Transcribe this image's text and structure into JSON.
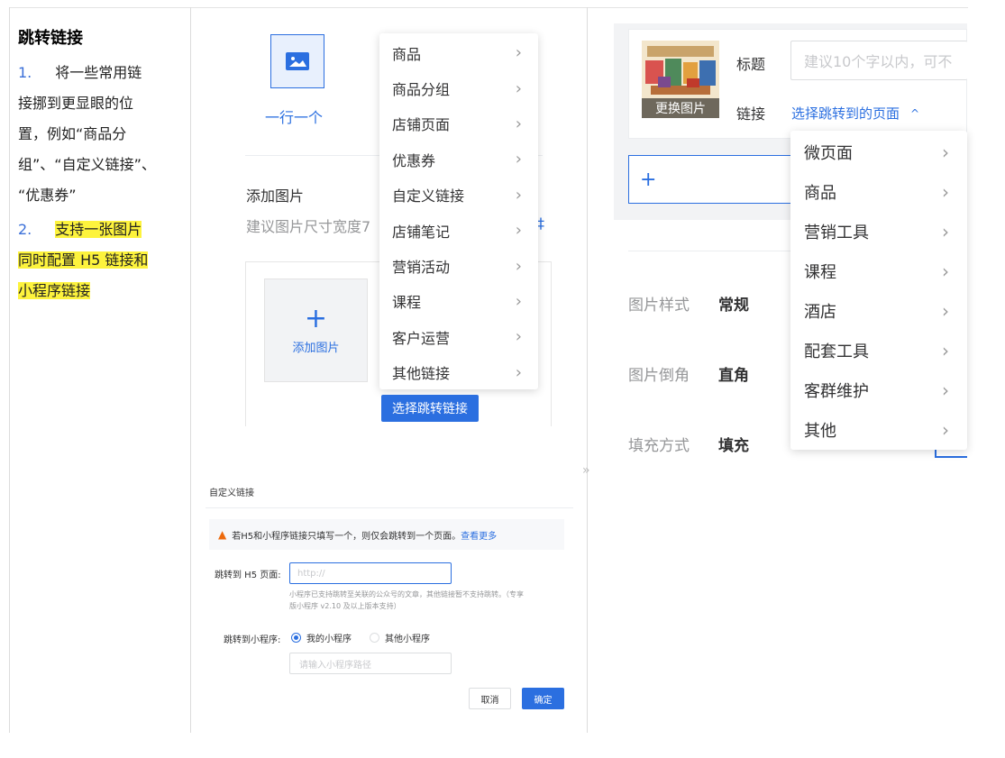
{
  "doc": {
    "title": "跳转链接",
    "item1_num": "1.",
    "item1_text_line1": "将一些常用链",
    "item1_text_line2": "接挪到更显眼的位",
    "item1_text_line3": "置，例如“商品分",
    "item1_text_line4": "组”、“自定义链接”、",
    "item1_text_line5": "“优惠券”",
    "item2_num": "2.",
    "item2_text_line1": "支持一张图片",
    "item2_text_line2": "同时配置 H5 链接和",
    "item2_text_line3": "小程序链接"
  },
  "middle": {
    "layout_option": "一行一个",
    "add_image_title": "添加图片",
    "add_image_hint": "建议图片尺寸宽度7",
    "add_image_box_label": "添加图片",
    "plus": "+",
    "select_link_button": "选择跳转链接",
    "menu": [
      {
        "label": "商品"
      },
      {
        "label": "商品分组"
      },
      {
        "label": "店铺页面"
      },
      {
        "label": "优惠券"
      },
      {
        "label": "自定义链接"
      },
      {
        "label": "店铺笔记"
      },
      {
        "label": "营销活动"
      },
      {
        "label": "课程"
      },
      {
        "label": "客户运营"
      },
      {
        "label": "其他链接"
      }
    ],
    "chevron": "›"
  },
  "dialog": {
    "title": "自定义链接",
    "warning_text": "若H5和小程序链接只填写一个，则仅会跳转到一个页面。",
    "warning_link": "查看更多",
    "h5_label": "跳转到 H5 页面:",
    "h5_placeholder": "http://",
    "h5_help_line1": "小程序已支持跳转至关联的公众号的文章，其他链接暂不支持跳转。（专享",
    "h5_help_line2": "版小程序 v2.10 及以上版本支持）",
    "mp_label": "跳转到小程序:",
    "radio_mine": "我的小程序",
    "radio_other": "其他小程序",
    "mp_path_placeholder": "请输入小程序路径",
    "cancel": "取消",
    "confirm": "确定"
  },
  "right": {
    "thumb_change": "更换图片",
    "title_label": "标题",
    "title_placeholder": "建议10个字以内，可不",
    "link_label": "链接",
    "link_select": "选择跳转到的页面",
    "caret_up": "^",
    "plus": "+",
    "style_label": "图片样式",
    "style_value": "常规",
    "corner_label": "图片倒角",
    "corner_value": "直角",
    "fill_label": "填充方式",
    "fill_value": "填充",
    "menu": [
      {
        "label": "微页面"
      },
      {
        "label": "商品"
      },
      {
        "label": "营销工具"
      },
      {
        "label": "课程"
      },
      {
        "label": "酒店"
      },
      {
        "label": "配套工具"
      },
      {
        "label": "客群维护"
      },
      {
        "label": "其他"
      }
    ],
    "chevron": "›"
  },
  "colors": {
    "accent": "#2b6fe0",
    "highlight": "#fdf33d",
    "warning": "#ed6a0c"
  }
}
